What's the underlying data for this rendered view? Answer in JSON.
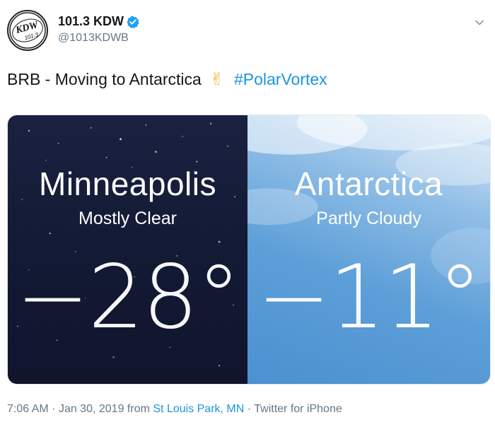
{
  "account": {
    "display_name": "101.3 KDW",
    "handle": "@1013KDWB",
    "avatar_text_top": "KDW",
    "avatar_text_bottom": "101.3",
    "verified_icon": "verified-badge-icon"
  },
  "tweet": {
    "text": "BRB - Moving to Antarctica",
    "emoji": "✌",
    "hashtag": "#PolarVortex"
  },
  "media": {
    "left": {
      "city": "Minneapolis",
      "condition": "Mostly Clear",
      "temperature": "−28°"
    },
    "right": {
      "city": "Antarctica",
      "condition": "Partly Cloudy",
      "temperature": "−11°"
    }
  },
  "meta": {
    "time": "7:06 AM",
    "separator": "·",
    "date": "Jan 30, 2019",
    "from_word": "from",
    "location": "St Louis Park, MN",
    "client": "Twitter for iPhone"
  },
  "colors": {
    "link": "#1b95e0",
    "night_panel": "#131a35",
    "sky_panel": "#5d9fd8",
    "muted_text": "#657786"
  }
}
